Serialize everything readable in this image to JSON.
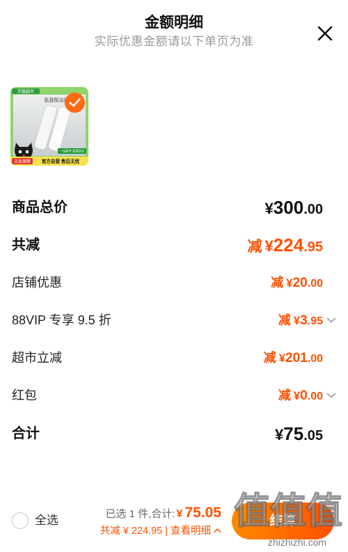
{
  "header": {
    "title": "金额明细",
    "subtitle": "实际优惠金额请以下单页为准",
    "close_icon": "close-icon"
  },
  "product": {
    "selected": true,
    "check_icon": "check-icon",
    "image": {
      "store_tag": "天猫超市",
      "product_name": "氨基酸洁面",
      "delivery_badge": "一站购齐 极速送达",
      "guarantee_badge": "正品保障",
      "service_text": "官方自营 售后无忧",
      "logo": "tmall-cat-logo"
    }
  },
  "rows": [
    {
      "label": "商品总价",
      "prefix": "",
      "currency": "¥",
      "integer": "300",
      "decimal": ".00",
      "color": "#111111",
      "emphasis": true,
      "has_dropdown": false
    },
    {
      "label": "共减",
      "prefix": "减",
      "currency": "¥",
      "integer": "224",
      "decimal": ".95",
      "color": "#ff5000",
      "emphasis": true,
      "has_dropdown": false
    },
    {
      "label": "店铺优惠",
      "prefix": "减",
      "currency": "¥",
      "integer": "20",
      "decimal": ".00",
      "color": "#ff5000",
      "emphasis": false,
      "has_dropdown": false
    },
    {
      "label": "88VIP 专享 9.5 折",
      "prefix": "减",
      "currency": "¥",
      "integer": "3",
      "decimal": ".95",
      "color": "#ff5000",
      "emphasis": false,
      "has_dropdown": true
    },
    {
      "label": "超市立减",
      "prefix": "减",
      "currency": "¥",
      "integer": "201",
      "decimal": ".00",
      "color": "#ff5000",
      "emphasis": false,
      "has_dropdown": false
    },
    {
      "label": "红包",
      "prefix": "减",
      "currency": "¥",
      "integer": "0",
      "decimal": ".00",
      "color": "#ff5000",
      "emphasis": false,
      "has_dropdown": true
    },
    {
      "label": "合计",
      "prefix": "",
      "currency": "¥",
      "integer": "75",
      "decimal": ".05",
      "color": "#111111",
      "emphasis": true,
      "has_dropdown": false
    }
  ],
  "dropdown_icon": "chevron-down-icon",
  "footer": {
    "select_all_label": "全选",
    "selected_text": "已选 1 件,合计:",
    "total_currency": "¥",
    "total_amount": "75.05",
    "saved_text": "共减 ¥ 224.95",
    "divider": "|",
    "details_link": "查看明细",
    "details_icon": "chevron-up-icon",
    "checkout_label": "结算"
  },
  "watermark": {
    "glyphs": "值值值",
    "url": "zhizhizhi.com"
  },
  "colors": {
    "accent": "#ff5000",
    "text": "#111111",
    "muted": "#999999",
    "check": "#ff6a13",
    "button_start": "#ff8a00",
    "button_end": "#ff5000"
  }
}
